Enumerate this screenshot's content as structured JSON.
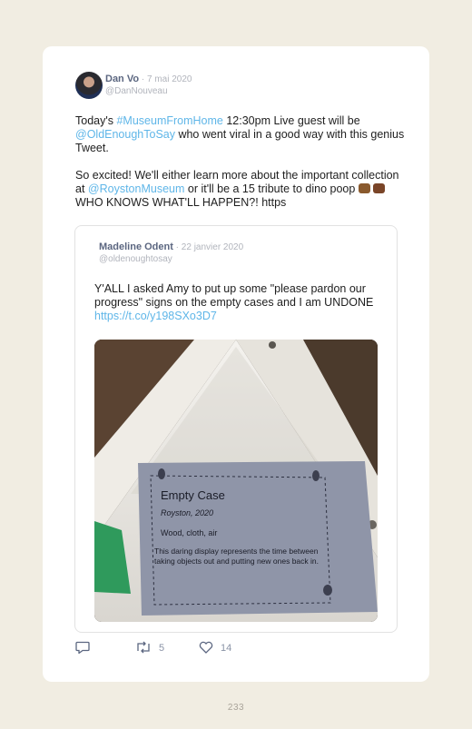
{
  "tweet": {
    "author_name": "Dan Vo",
    "date": " · 7 mai 2020",
    "handle": "@DanNouveau",
    "text_parts": {
      "p1_a": "Today's ",
      "p1_hashtag": "#MuseumFromHome",
      "p1_b": " 12:30pm Live guest will be ",
      "p1_mention": "@OldEnoughToSay",
      "p1_c": " who went viral in a good way with this genius Tweet.",
      "p2_a": "So excited! We'll either learn more about the important collection at ",
      "p2_mention": "@RoystonMuseum",
      "p2_b": " or it'll be a 15 tribute to dino poop ",
      "p2_c": " WHO KNOWS WHAT'LL HAPPEN?! https"
    }
  },
  "quoted": {
    "author_name": "Madeline Odent",
    "date": " · 22 janvier 2020",
    "handle": "@oldenoughtosay",
    "text": "Y'ALL I asked Amy to put up some \"please pardon our progress\" signs on the empty cases and I am UNDONE ",
    "link": "https://t.co/y198SXo3D7",
    "photo": {
      "sign_title": "Empty Case",
      "sign_line1": "Royston, 2020",
      "sign_line2": "Wood, cloth, air",
      "sign_desc": "This daring display represents the time between taking objects out and putting new ones back in."
    }
  },
  "actions": {
    "reply_icon": "reply-icon",
    "retweet_icon": "retweet-icon",
    "like_icon": "heart-icon",
    "retweets": "5",
    "likes": "14"
  },
  "page_number": "233",
  "colors": {
    "background": "#f1ede2",
    "link": "#5fb6e8",
    "name": "#5b6680"
  }
}
